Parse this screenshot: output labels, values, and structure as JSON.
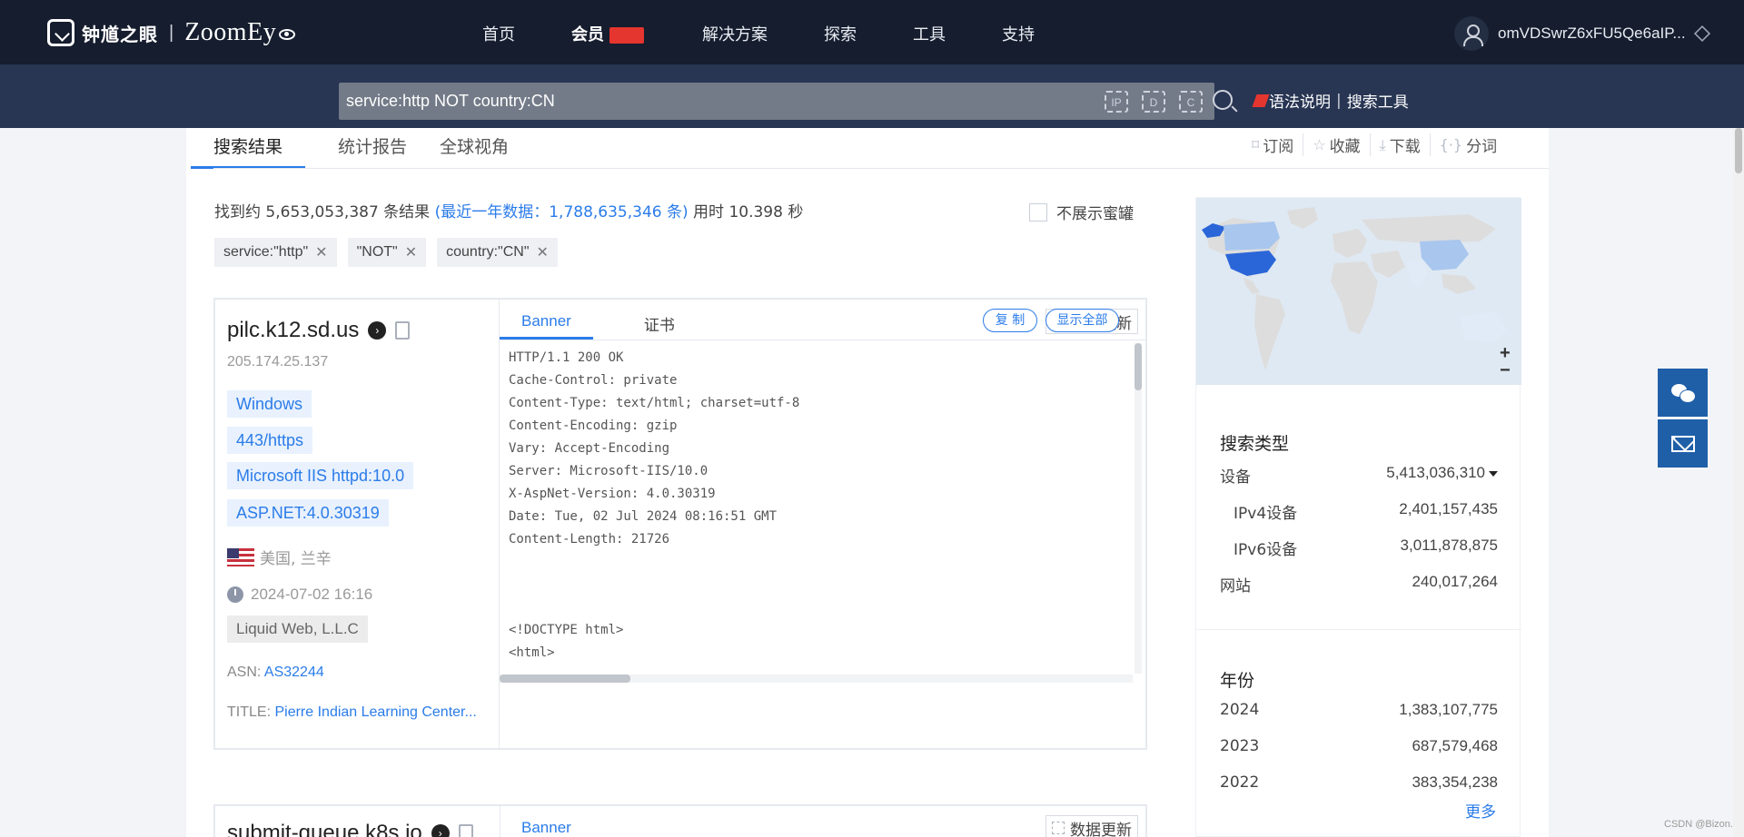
{
  "nav": {
    "logo_cn": "钟馗之眼",
    "logo_sep": "|",
    "logo_en": "ZoomEy",
    "links": [
      "首页",
      "会员",
      "解决方案",
      "探索",
      "工具",
      "支持"
    ],
    "user": "omVDSwrZ6xFU5Qe6aIP..."
  },
  "search": {
    "query": "service:http NOT country:CN",
    "icons": [
      "IP",
      "D",
      "C"
    ],
    "syntax_link": "语法说明",
    "sep": "|",
    "tools_link": "搜索工具"
  },
  "tabs": [
    "搜索结果",
    "统计报告",
    "全球视角"
  ],
  "tab_tools": [
    {
      "icon": "bookmark",
      "label": "订阅"
    },
    {
      "icon": "star",
      "label": "收藏"
    },
    {
      "icon": "download",
      "label": "下载"
    },
    {
      "icon": "braces",
      "label": "分词"
    }
  ],
  "summary": {
    "prefix": "找到约 5,653,053,387 条结果",
    "recent": "(最近一年数据：1,788,635,346 条)",
    "elapsed": "用时 10.398 秒"
  },
  "honeypot_label": "不展示蜜罐",
  "chips": [
    "service:\"http\"",
    "\"NOT\"",
    "country:\"CN\""
  ],
  "result": {
    "host": "pilc.k12.sd.us",
    "ip": "205.174.25.137",
    "tags": [
      "Windows",
      "443/https",
      "Microsoft IIS httpd:10.0",
      "ASP.NET:4.0.30319"
    ],
    "location": "美国, 兰辛",
    "time": "2024-07-02 16:16",
    "org": "Liquid Web, L.L.C",
    "asn_label": "ASN:",
    "asn": "AS32244",
    "title_label": "TITLE:",
    "title": "Pierre Indian Learning Center...",
    "banner_tab": "Banner",
    "cert_tab": "证书",
    "update_btn": "数据更新",
    "copy_btn": "复 制",
    "show_all_btn": "显示全部",
    "banner": "HTTP/1.1 200 OK\nCache-Control: private\nContent-Type: text/html; charset=utf-8\nContent-Encoding: gzip\nVary: Accept-Encoding\nServer: Microsoft-IIS/10.0\nX-AspNet-Version: 4.0.30319\nDate: Tue, 02 Jul 2024 08:16:51 GMT\nContent-Length: 21726\n\n\n\n<!DOCTYPE html>\n<html>"
  },
  "result2": {
    "host": "submit-queue.k8s.io",
    "banner_tab": "Banner",
    "update_btn": "数据更新"
  },
  "side": {
    "zoom_in": "+",
    "zoom_out": "−",
    "search_type_title": "搜索类型",
    "search_types": [
      {
        "label": "设备",
        "value": "5,413,036,310",
        "sub": false
      },
      {
        "label": "IPv4设备",
        "value": "2,401,157,435",
        "sub": true
      },
      {
        "label": "IPv6设备",
        "value": "3,011,878,875",
        "sub": true
      },
      {
        "label": "网站",
        "value": "240,017,264",
        "sub": false
      }
    ],
    "year_title": "年份",
    "years": [
      {
        "label": "2024",
        "value": "1,383,107,775"
      },
      {
        "label": "2023",
        "value": "687,579,468"
      },
      {
        "label": "2022",
        "value": "383,354,238"
      }
    ],
    "more": "更多"
  },
  "watermark": "CSDN @Bizon.",
  "colors": {
    "nav_bg": "#151d2e",
    "search_band": "#283553",
    "accent": "#2b7ce9",
    "vip_badge": "#e5352f",
    "float_btn": "#1f5fa8"
  }
}
